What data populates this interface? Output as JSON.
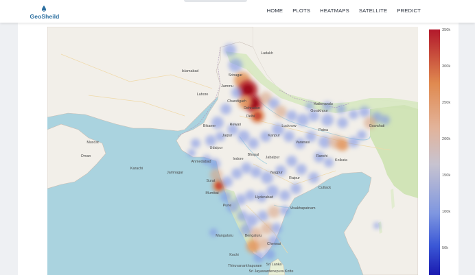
{
  "app": {
    "brand": "GeoSheild"
  },
  "nav": {
    "items": [
      "HOME",
      "PLOTS",
      "HEATMAPS",
      "SATELLITE",
      "PREDICT"
    ]
  },
  "map": {
    "type": "density heatmap",
    "labels": {
      "srinagar": "Srinagar",
      "jammu": "Jammu",
      "ladakh": "Ladakh",
      "chandigarh": "Chandigarh",
      "shimla": "Shimla",
      "dehradun": "Dehradun",
      "delhi": "Delhi",
      "rewari": "Rewari",
      "bikaner": "Bikaner",
      "jaipur": "Jaipur",
      "lucknow": "Lucknow",
      "kanpur": "Kanpur",
      "varanasi": "Varanasi",
      "patna": "Patna",
      "gorakhpur": "Gorakhpur",
      "udaipur": "Udaipur",
      "bhopal": "Bhopal",
      "indore": "Indore",
      "jabalpur": "Jabalpur",
      "ahmedabad": "Ahmedabad",
      "jamnagar": "Jamnagar",
      "surat": "Surat",
      "nagpur": "Nagpur",
      "raipur": "Raipur",
      "ranchi": "Ranchi",
      "kolkata": "Kolkata",
      "cuttack": "Cuttack",
      "mumbai": "Mumbai",
      "pune": "Pune",
      "hyderabad": "Hyderabad",
      "visakhapatnam": "Visakhapatnam",
      "bengaluru": "Bengaluru",
      "chennai": "Chennai",
      "mangaluru": "Mangaluru",
      "kochi": "Kochi",
      "thiruvananthapuram": "Thiruvananthapuram",
      "srilanka": "Sri Lanka",
      "colombo": "Sri Jayawardenepura Kotte",
      "guwahati": "Guwahati",
      "dhaka": "Dhaka",
      "karachi": "Karachi",
      "lahore": "Lahore",
      "islamabad": "Islamabad",
      "kathmandu": "Kathmandu",
      "oman": "Oman",
      "muscat": "Muscat",
      "nepal_region": "Nepal"
    }
  },
  "colorbar": {
    "ticks": [
      "350k",
      "300k",
      "250k",
      "200k",
      "150k",
      "100k",
      "50k"
    ],
    "colors": [
      "#b2182b",
      "#e08a50",
      "#e2b39a",
      "#c7c3d0",
      "#7e96e0",
      "#3b58d6",
      "#1a1ab0"
    ]
  },
  "colors": {
    "brand": "#2c6fa0",
    "sea": "#aad3df",
    "land": "#f2efe9",
    "green": "#cde3b4"
  }
}
